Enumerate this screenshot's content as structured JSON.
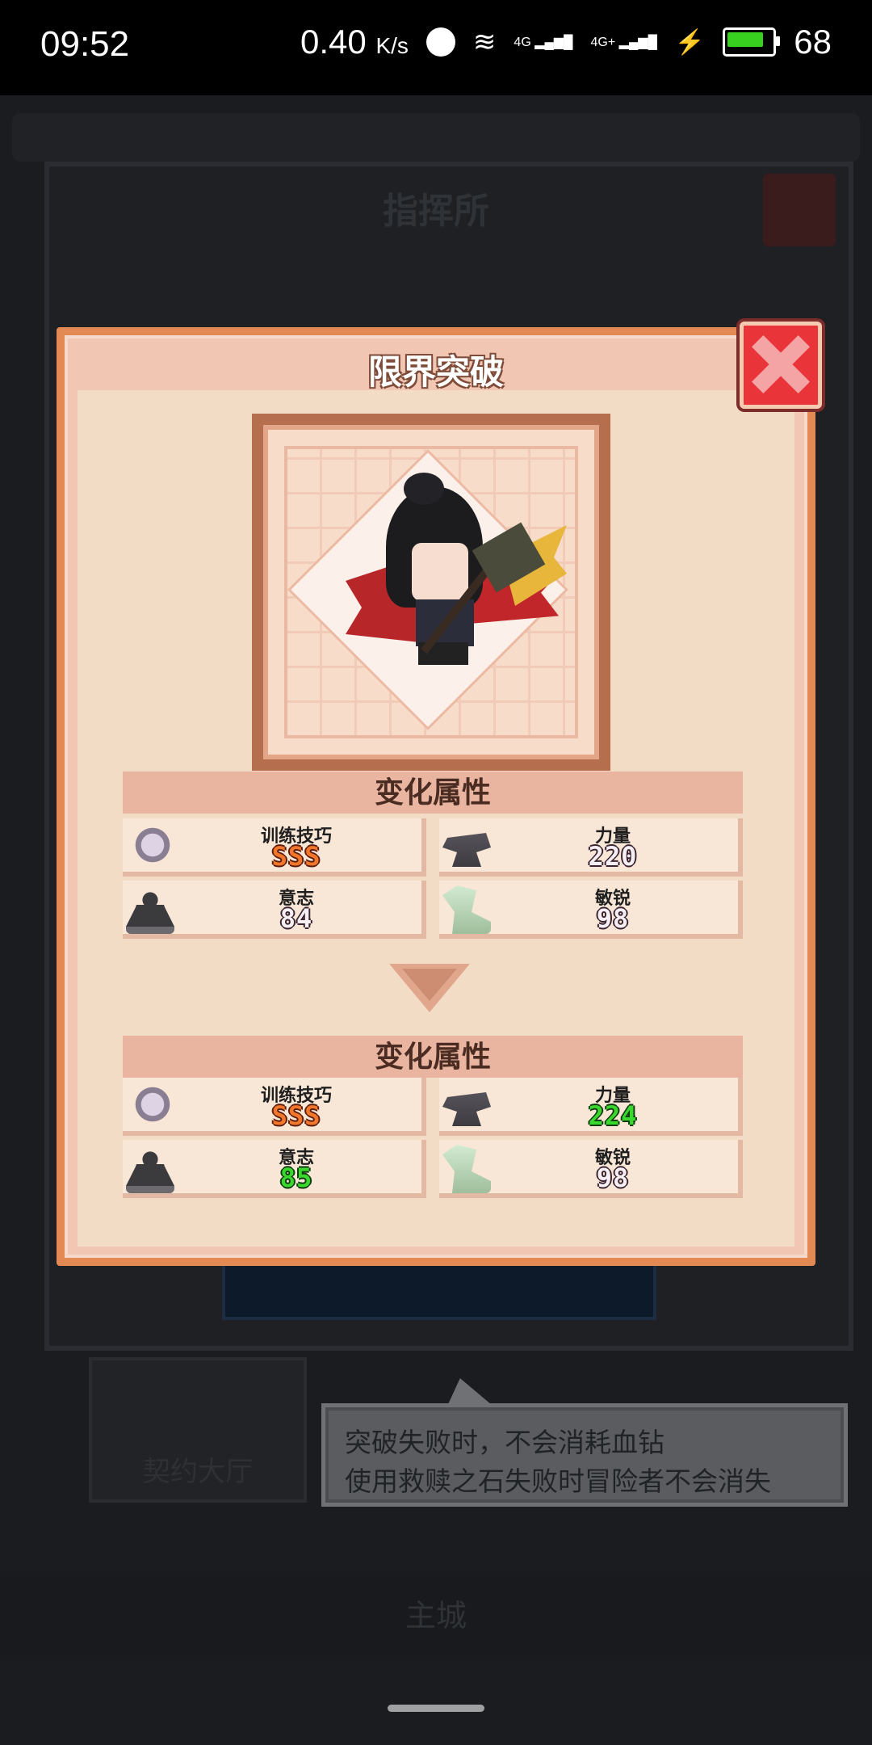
{
  "status_bar": {
    "time": "09:52",
    "net_speed": "0.40",
    "net_unit": "K/s",
    "signal_1": "4G",
    "signal_2": "4G+",
    "battery": "68",
    "battery_color": "#39d11f"
  },
  "background": {
    "title": "指挥所",
    "hall_label": "契约大厅",
    "bottom_tab": "主城"
  },
  "dialog": {
    "title": "限界突破",
    "before": {
      "header": "变化属性",
      "stats": [
        {
          "icon": "sword-icon",
          "label": "训练技巧",
          "value": "SSS",
          "color": "orange"
        },
        {
          "icon": "anvil-icon",
          "label": "力量",
          "value": "220",
          "color": "white"
        },
        {
          "icon": "meditation-icon",
          "label": "意志",
          "value": "84",
          "color": "white"
        },
        {
          "icon": "boot-icon",
          "label": "敏锐",
          "value": "98",
          "color": "white"
        }
      ]
    },
    "after": {
      "header": "变化属性",
      "stats": [
        {
          "icon": "sword-icon",
          "label": "训练技巧",
          "value": "SSS",
          "color": "orange"
        },
        {
          "icon": "anvil-icon",
          "label": "力量",
          "value": "224",
          "color": "green"
        },
        {
          "icon": "meditation-icon",
          "label": "意志",
          "value": "85",
          "color": "green"
        },
        {
          "icon": "boot-icon",
          "label": "敏锐",
          "value": "98",
          "color": "white"
        }
      ]
    }
  },
  "tooltip": {
    "line1": "突破失败时，不会消耗血钻",
    "line2": "使用救赎之石失败时冒险者不会消失"
  }
}
